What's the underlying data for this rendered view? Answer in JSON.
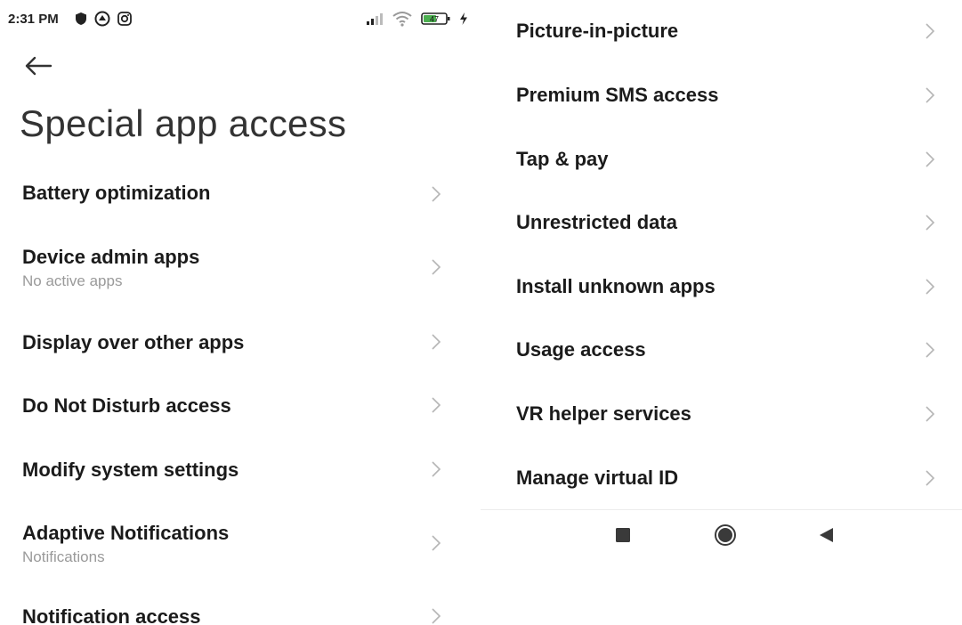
{
  "status_bar": {
    "time": "2:31 PM",
    "left_icons": [
      "shield-icon",
      "vpn-icon",
      "instagram-icon"
    ],
    "right_icons": [
      "signal-icon",
      "wifi-icon",
      "battery-icon",
      "charging-icon"
    ],
    "battery_level": "47"
  },
  "header": {
    "back_icon": "back-arrow-icon",
    "title": "Special app access"
  },
  "left_list": {
    "items": [
      {
        "title": "Battery optimization",
        "subtitle": ""
      },
      {
        "title": "Device admin apps",
        "subtitle": "No active apps"
      },
      {
        "title": "Display over other apps",
        "subtitle": ""
      },
      {
        "title": "Do Not Disturb access",
        "subtitle": ""
      },
      {
        "title": "Modify system settings",
        "subtitle": ""
      },
      {
        "title": "Adaptive Notifications",
        "subtitle": "Notifications"
      },
      {
        "title": "Notification access",
        "subtitle": ""
      }
    ]
  },
  "right_list": {
    "items": [
      {
        "title": "Picture-in-picture"
      },
      {
        "title": "Premium SMS access"
      },
      {
        "title": "Tap & pay"
      },
      {
        "title": "Unrestricted data"
      },
      {
        "title": "Install unknown apps"
      },
      {
        "title": "Usage access"
      },
      {
        "title": "VR helper services"
      },
      {
        "title": "Manage virtual ID"
      }
    ]
  },
  "nav_bar": {
    "buttons": [
      "recents-square-icon",
      "home-circle-icon",
      "back-triangle-icon"
    ]
  },
  "colors": {
    "background": "#ffffff",
    "title_text": "#1b1b1b",
    "subtitle_text": "#9a9a9a",
    "chevron": "#b5b5b5",
    "battery_fill": "#4caf50"
  }
}
